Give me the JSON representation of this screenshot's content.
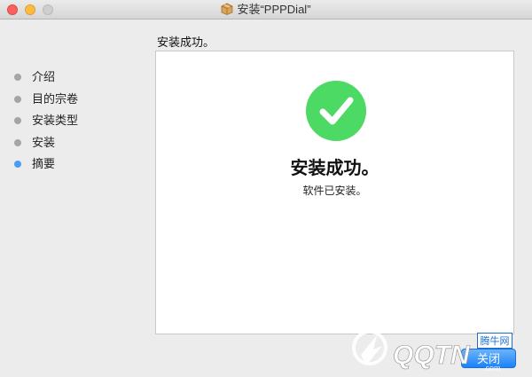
{
  "window": {
    "title": "安装“PPPDial”"
  },
  "sidebar": {
    "items": [
      {
        "label": "介绍",
        "active": false
      },
      {
        "label": "目的宗卷",
        "active": false
      },
      {
        "label": "安装类型",
        "active": false
      },
      {
        "label": "安装",
        "active": false
      },
      {
        "label": "摘要",
        "active": true
      }
    ]
  },
  "main": {
    "header": "安装成功。",
    "headline": "安装成功。",
    "message": "软件已安装。"
  },
  "footer": {
    "close_label": "关闭"
  },
  "watermark": {
    "brand": "QQTN",
    "tag": "腾牛网"
  },
  "colors": {
    "success": "#4cd964",
    "active_step": "#4a9ef1",
    "button": "#1a82fb"
  },
  "icons": [
    "package-icon",
    "checkmark-icon"
  ]
}
